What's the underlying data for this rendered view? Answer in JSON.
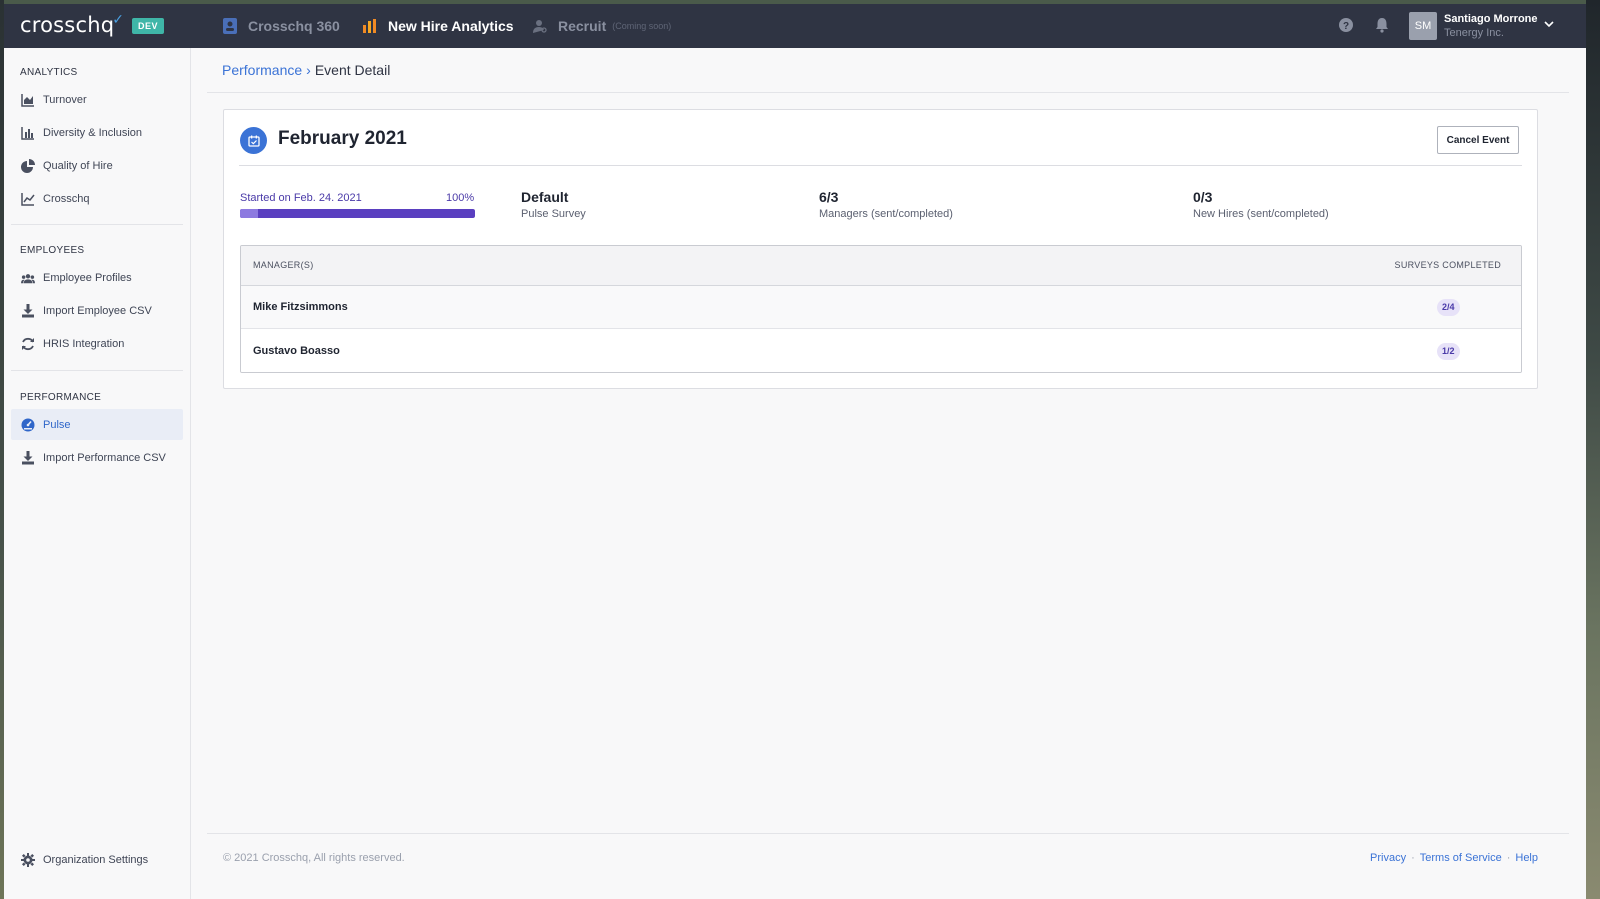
{
  "app": {
    "logo": "crosschq",
    "env_badge": "DEV"
  },
  "topnav": {
    "items": [
      {
        "label": "Crosschq 360",
        "icon": "id-card-icon"
      },
      {
        "label": "New Hire Analytics",
        "icon": "bar-chart-icon"
      },
      {
        "label": "Recruit",
        "note": "(Coming soon)",
        "icon": "user-search-icon"
      }
    ],
    "user": {
      "initials": "SM",
      "name": "Santiago Morrone",
      "org": "Tenergy Inc."
    }
  },
  "sidebar": {
    "sections": [
      {
        "title": "ANALYTICS",
        "items": [
          {
            "label": "Turnover",
            "icon": "area-chart-icon"
          },
          {
            "label": "Diversity & Inclusion",
            "icon": "bar-chart-icon"
          },
          {
            "label": "Quality of Hire",
            "icon": "pie-chart-icon"
          },
          {
            "label": "Crosschq",
            "icon": "line-chart-icon"
          }
        ]
      },
      {
        "title": "EMPLOYEES",
        "items": [
          {
            "label": "Employee Profiles",
            "icon": "users-icon"
          },
          {
            "label": "Import Employee CSV",
            "icon": "download-icon"
          },
          {
            "label": "HRIS Integration",
            "icon": "sync-icon"
          }
        ]
      },
      {
        "title": "PERFORMANCE",
        "items": [
          {
            "label": "Pulse",
            "icon": "gauge-icon",
            "active": true
          },
          {
            "label": "Import Performance CSV",
            "icon": "download-icon"
          }
        ]
      }
    ],
    "settings_label": "Organization Settings"
  },
  "breadcrumb": {
    "parent": "Performance",
    "separator": "›",
    "current": "Event Detail"
  },
  "event": {
    "title": "February 2021",
    "cancel_label": "Cancel Event",
    "progress": {
      "label": "Started on Feb. 24. 2021",
      "percent_text": "100%",
      "percent": 100
    },
    "stats": [
      {
        "value": "Default",
        "caption": "Pulse Survey"
      },
      {
        "value": "6/3",
        "caption": "Managers (sent/completed)"
      },
      {
        "value": "0/3",
        "caption": "New Hires (sent/completed)"
      }
    ],
    "table": {
      "headers": [
        "MANAGER(S)",
        "SURVEYS COMPLETED"
      ],
      "rows": [
        {
          "name": "Mike Fitzsimmons",
          "completed": "2/4"
        },
        {
          "name": "Gustavo Boasso",
          "completed": "1/2"
        }
      ]
    }
  },
  "footer": {
    "copyright": "© 2021 Crosschq, All rights reserved.",
    "links": [
      "Privacy",
      "Terms of Service",
      "Help"
    ]
  },
  "colors": {
    "nav_bg": "#2f3443",
    "accent": "#3b73d6",
    "progress": "#5a3fc0",
    "badge": "#3fb6a8"
  }
}
